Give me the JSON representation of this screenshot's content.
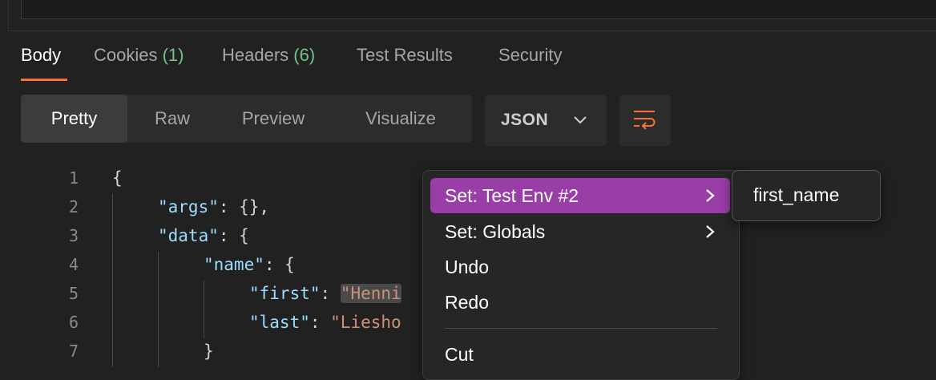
{
  "response_tabs": [
    {
      "label": "Body",
      "count": null,
      "active": true
    },
    {
      "label": "Cookies",
      "count": "(1)",
      "active": false
    },
    {
      "label": "Headers",
      "count": "(6)",
      "active": false
    },
    {
      "label": "Test Results",
      "count": null,
      "active": false
    },
    {
      "label": "Security",
      "count": null,
      "active": false
    }
  ],
  "view_modes": [
    {
      "label": "Pretty",
      "active": true
    },
    {
      "label": "Raw",
      "active": false
    },
    {
      "label": "Preview",
      "active": false
    },
    {
      "label": "Visualize",
      "active": false
    }
  ],
  "format_select": {
    "value": "JSON",
    "icon": "chevron-down-icon"
  },
  "wrap_button": {
    "icon": "text-wrap-icon",
    "color": "#ff6c37"
  },
  "code": {
    "line_numbers": [
      "1",
      "2",
      "3",
      "4",
      "5",
      "6",
      "7"
    ],
    "lines": [
      "{",
      "\"args\": {},",
      "\"data\": {",
      "\"name\": {",
      "\"first\": \"Henni",
      "\"last\": \"Liesho",
      "}"
    ]
  },
  "context_menu": {
    "items": [
      {
        "label": "Set: Test Env #2",
        "submenu": true,
        "highlighted": true
      },
      {
        "label": "Set: Globals",
        "submenu": true,
        "highlighted": false
      },
      {
        "label": "Undo",
        "submenu": false,
        "highlighted": false
      },
      {
        "label": "Redo",
        "submenu": false,
        "highlighted": false
      },
      {
        "label": "Cut",
        "submenu": false,
        "highlighted": false
      }
    ],
    "highlight_color": "#993ea7"
  },
  "submenu": {
    "items": [
      {
        "label": "first_name"
      }
    ]
  },
  "colors": {
    "accent": "#ff6c37",
    "count": "#6fc28c",
    "json_key": "#9cdcfe",
    "json_string": "#ce9178"
  }
}
